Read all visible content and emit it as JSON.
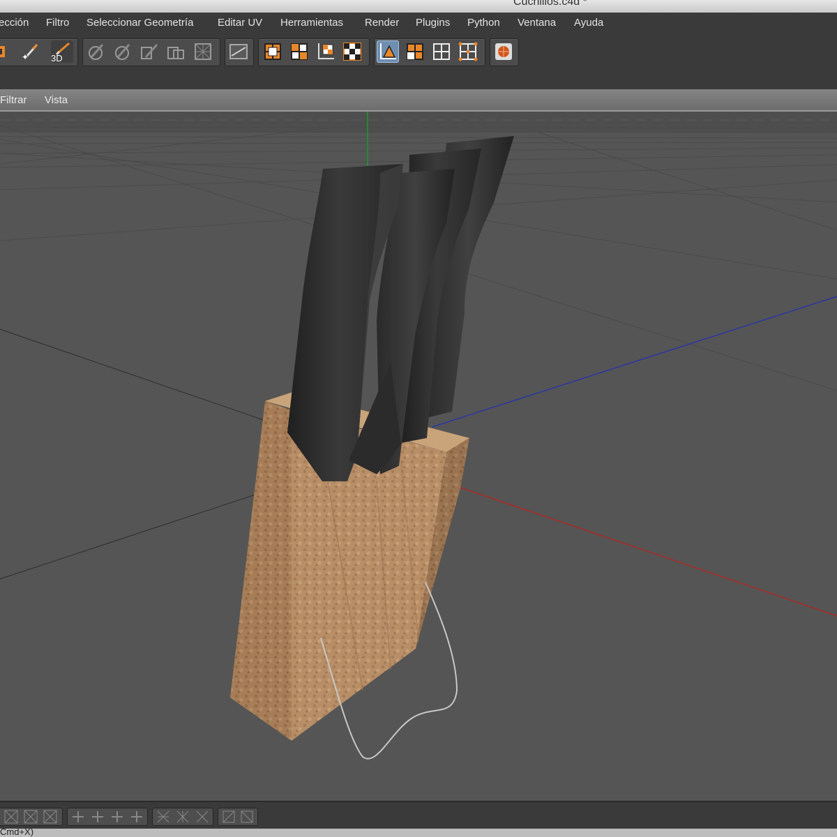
{
  "window": {
    "title": "Cuchillos.c4d *"
  },
  "menu": {
    "items": [
      "ección",
      "Filtro",
      "Seleccionar Geometría",
      "Editar UV",
      "Herramientas",
      "Render",
      "Plugins",
      "Python",
      "Ventana",
      "Ayuda"
    ]
  },
  "toolbar": {
    "groups": [
      {
        "name": "paint-tools",
        "icons": [
          "paint-edge-icon",
          "magic-brush-icon",
          "paint-3d-icon"
        ]
      },
      {
        "name": "uv-tools",
        "icons": [
          "uv-tool-1-icon",
          "uv-tool-2-icon",
          "uv-tool-3-icon",
          "uv-tool-4-icon",
          "uv-tool-5-icon"
        ]
      },
      {
        "name": "texture-tools",
        "icons": [
          "texture-view-icon"
        ]
      },
      {
        "name": "uv-modes",
        "icons": [
          "uv-points-icon",
          "uv-polygons-icon",
          "uv-transform-icon",
          "checker-icon"
        ]
      },
      {
        "name": "edit-modes",
        "icons": [
          "model-mode-icon",
          "polygon-mode-icon",
          "uv-grid-icon",
          "uv-points-grid-icon"
        ]
      },
      {
        "name": "render-tools",
        "icons": [
          "render-view-icon"
        ]
      }
    ],
    "paint_3d_label": "3D"
  },
  "viewport_menu": {
    "items": [
      "Filtrar",
      "Vista"
    ]
  },
  "status": {
    "text": "Cmd+X)"
  },
  "colors": {
    "accent_orange": "#e8872a",
    "active_blue": "#6f8fb2",
    "axis_x": "#c0201a",
    "axis_y": "#1a9a2a",
    "axis_z": "#2030b8",
    "wood": "#b08660",
    "blade": "#2e2e2e"
  }
}
